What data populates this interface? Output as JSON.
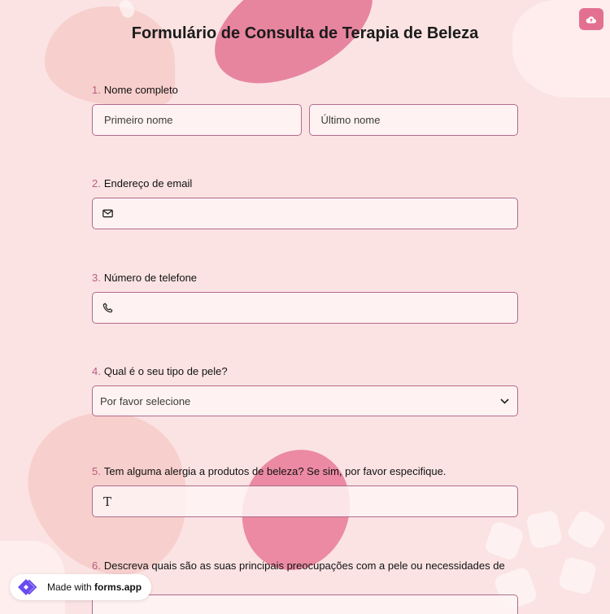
{
  "form": {
    "title": "Formulário de Consulta de Terapia de Beleza"
  },
  "questions": [
    {
      "number": "1.",
      "label": "Nome completo",
      "first_placeholder": "Primeiro nome",
      "last_placeholder": "Último nome"
    },
    {
      "number": "2.",
      "label": "Endereço de email",
      "icon": "envelope-icon"
    },
    {
      "number": "3.",
      "label": "Número de telefone",
      "icon": "phone-icon"
    },
    {
      "number": "4.",
      "label": "Qual é o seu tipo de pele?",
      "selected": "Por favor selecione",
      "icon": "chevron-down-icon"
    },
    {
      "number": "5.",
      "label": "Tem alguma alergia a produtos de beleza? Se sim, por favor especifique.",
      "icon_glyph": "T"
    },
    {
      "number": "6.",
      "label": "Descreva quais são as suas principais preocupações com a pele ou necessidades de tratamento."
    }
  ],
  "badge": {
    "prefix": "Made with",
    "brand": "forms.app"
  },
  "colors": {
    "background": "#fbe3e3",
    "accent": "#e4708f",
    "number": "#b65d82",
    "field_border": "#b16b8e"
  }
}
